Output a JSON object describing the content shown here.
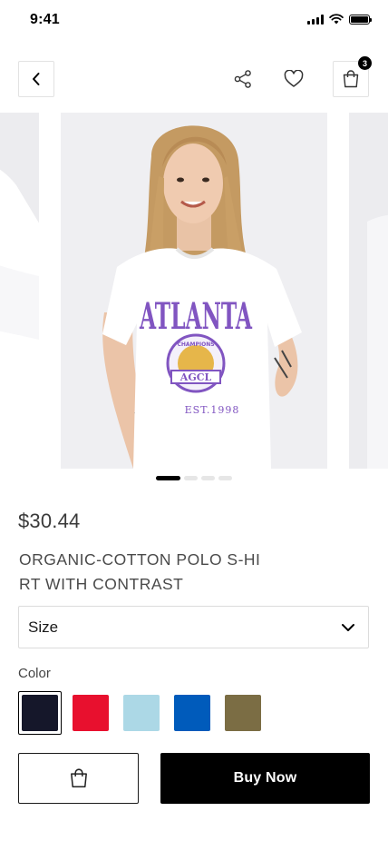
{
  "status_bar": {
    "time": "9:41"
  },
  "header": {
    "cart_count": "3"
  },
  "carousel": {
    "slide_count": 4,
    "active_index": 0,
    "shirt_text": "ATLANTA",
    "emblem_text": "AGCL",
    "emblem_ring_text": "CHAMPIONS",
    "est_text": "EST.1998"
  },
  "product": {
    "price": "$30.44",
    "title": "ORGANIC-COTTON POLO S-HIRT WITH CONTRAST"
  },
  "size": {
    "label": "Size"
  },
  "color": {
    "label": "Color",
    "selected_index": 0,
    "swatches": [
      "#15172a",
      "#e8102e",
      "#acd8e6",
      "#005bbb",
      "#7b6d44"
    ]
  },
  "actions": {
    "buy_label": "Buy Now"
  }
}
